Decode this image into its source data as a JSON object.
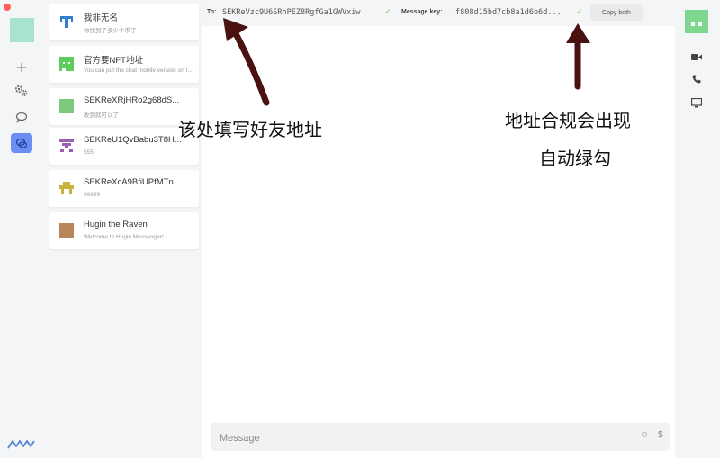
{
  "rail": {
    "items": [
      {
        "name": "add-icon",
        "active": false
      },
      {
        "name": "settings-icon",
        "active": false
      },
      {
        "name": "chat-icon",
        "active": false
      },
      {
        "name": "messages-icon",
        "active": true
      }
    ],
    "accent": "#6b8ef2"
  },
  "contacts": [
    {
      "name": "我非无名",
      "message": "你找到了多少个币了",
      "avatar_color": "#2f7fd0"
    },
    {
      "name": "官方要NFT地址",
      "message": "You can put the chat mobile version on t...",
      "avatar_color": "#5ccc5c"
    },
    {
      "name": "SEKReXRjHRo2g68dS...",
      "message": "收到就可以了",
      "avatar_color": "#7ec97e"
    },
    {
      "name": "SEKReU1QvBabu3T8H...",
      "message": "555",
      "avatar_color": "#9a5fb5"
    },
    {
      "name": "SEKReXcA9BfiUPfMTn...",
      "message": "99999",
      "avatar_color": "#c9b23a"
    },
    {
      "name": "Hugin the Raven",
      "message": "Welcome to Hugin Messenger!",
      "avatar_color": "#b9855a"
    }
  ],
  "topbar": {
    "to_label": "To:",
    "to_value": "SEKReVzc9U6SRhPEZ8RgfGa1GWVxiw",
    "key_label": "Message key:",
    "key_value": "f808d15bd7cb8a1d6b6d...",
    "copy_label": "Copy both"
  },
  "composer": {
    "placeholder": "Message",
    "emoji_glyph": "☺",
    "dollar_glyph": "$"
  },
  "right": {
    "buttons": [
      "video-icon",
      "phone-icon",
      "screen-share-icon"
    ]
  },
  "annotations": {
    "left": "该处填写好友地址",
    "right_line1": "地址合规会出现",
    "right_line2": "自动绿勾"
  }
}
